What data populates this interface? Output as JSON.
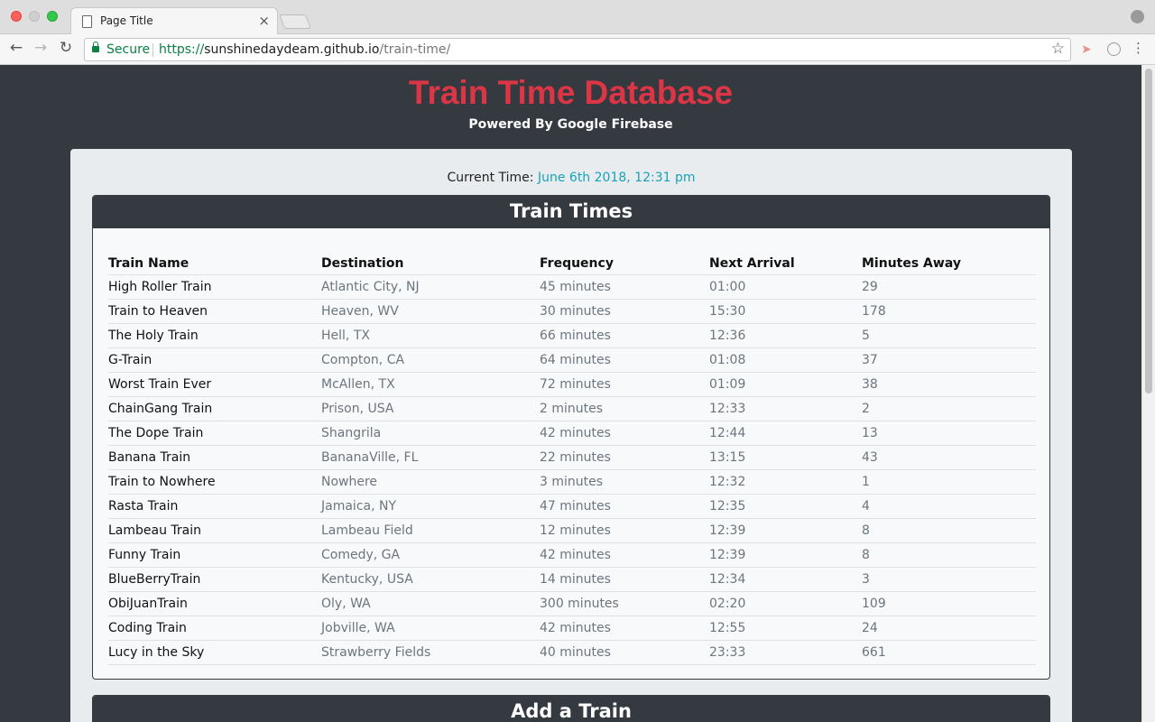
{
  "browser": {
    "tab_title": "Page Title",
    "tab_close": "×",
    "secure_label": "Secure",
    "url_scheme": "https://",
    "url_host": "sunshinedaydeam.github.io",
    "url_path": "/train-time/"
  },
  "header": {
    "title": "Train Time Database",
    "subtitle": "Powered By Google Firebase"
  },
  "current_time": {
    "label": "Current Time:",
    "value": "June 6th 2018, 12:31 pm"
  },
  "train_times": {
    "title": "Train Times",
    "columns": [
      "Train Name",
      "Destination",
      "Frequency",
      "Next Arrival",
      "Minutes Away"
    ],
    "rows": [
      [
        "High Roller Train",
        "Atlantic City, NJ",
        "45 minutes",
        "01:00",
        "29"
      ],
      [
        "Train to Heaven",
        "Heaven, WV",
        "30 minutes",
        "15:30",
        "178"
      ],
      [
        "The Holy Train",
        "Hell, TX",
        "66 minutes",
        "12:36",
        "5"
      ],
      [
        "G-Train",
        "Compton, CA",
        "64 minutes",
        "01:08",
        "37"
      ],
      [
        "Worst Train Ever",
        "McAllen, TX",
        "72 minutes",
        "01:09",
        "38"
      ],
      [
        "ChainGang Train",
        "Prison, USA",
        "2 minutes",
        "12:33",
        "2"
      ],
      [
        "The Dope Train",
        "Shangrila",
        "42 minutes",
        "12:44",
        "13"
      ],
      [
        "Banana Train",
        "BananaVille, FL",
        "22 minutes",
        "13:15",
        "43"
      ],
      [
        "Train to Nowhere",
        "Nowhere",
        "3 minutes",
        "12:32",
        "1"
      ],
      [
        "Rasta Train",
        "Jamaica, NY",
        "47 minutes",
        "12:35",
        "4"
      ],
      [
        "Lambeau Train",
        "Lambeau Field",
        "12 minutes",
        "12:39",
        "8"
      ],
      [
        "Funny Train",
        "Comedy, GA",
        "42 minutes",
        "12:39",
        "8"
      ],
      [
        "BlueBerryTrain",
        "Kentucky, USA",
        "14 minutes",
        "12:34",
        "3"
      ],
      [
        "ObiJuanTrain",
        "Oly, WA",
        "300 minutes",
        "02:20",
        "109"
      ],
      [
        "Coding Train",
        "Jobville, WA",
        "42 minutes",
        "12:55",
        "24"
      ],
      [
        "Lucy in the Sky",
        "Strawberry Fields",
        "40 minutes",
        "23:33",
        "661"
      ]
    ]
  },
  "add_train": {
    "title": "Add a Train"
  }
}
